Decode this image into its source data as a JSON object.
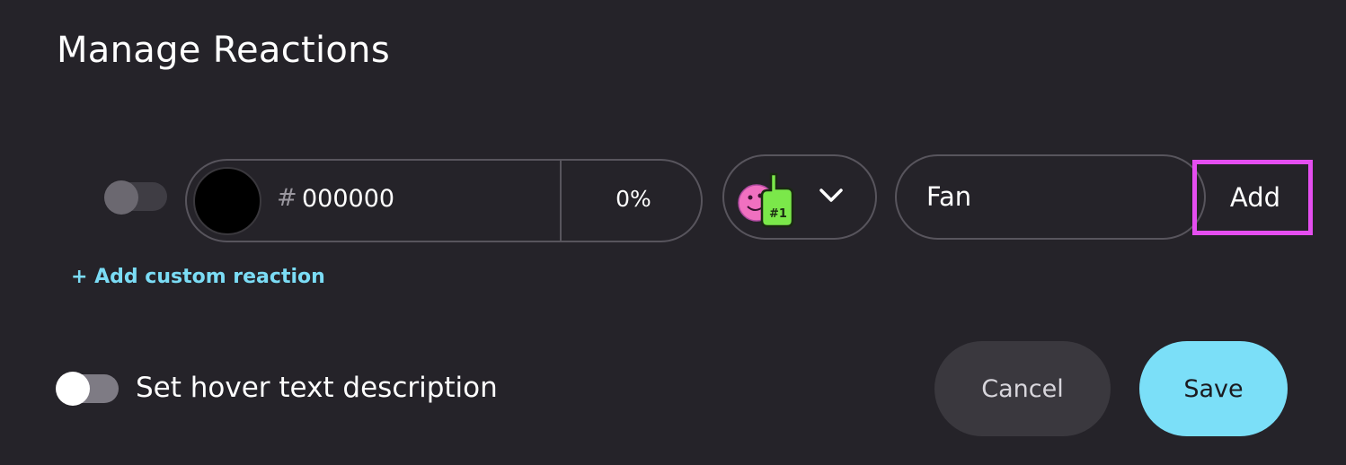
{
  "title": "Manage Reactions",
  "reaction_row": {
    "enabled_toggle_on": false,
    "color": {
      "hash_symbol": "#",
      "hex": "000000",
      "swatch_color": "#000000"
    },
    "opacity": "0%",
    "emoji": {
      "icon": "foam-finger-number-one-icon",
      "dropdown_icon": "chevron-down-icon"
    },
    "name_value": "Fan",
    "add_label": "Add"
  },
  "add_custom_reaction_label": "+ Add custom reaction",
  "hover_text": {
    "label": "Set hover text description",
    "toggle_on": false
  },
  "buttons": {
    "cancel": "Cancel",
    "save": "Save"
  },
  "colors": {
    "background": "#252329",
    "accent_cyan": "#7bdff8",
    "highlight_magenta": "#e54ef0"
  }
}
